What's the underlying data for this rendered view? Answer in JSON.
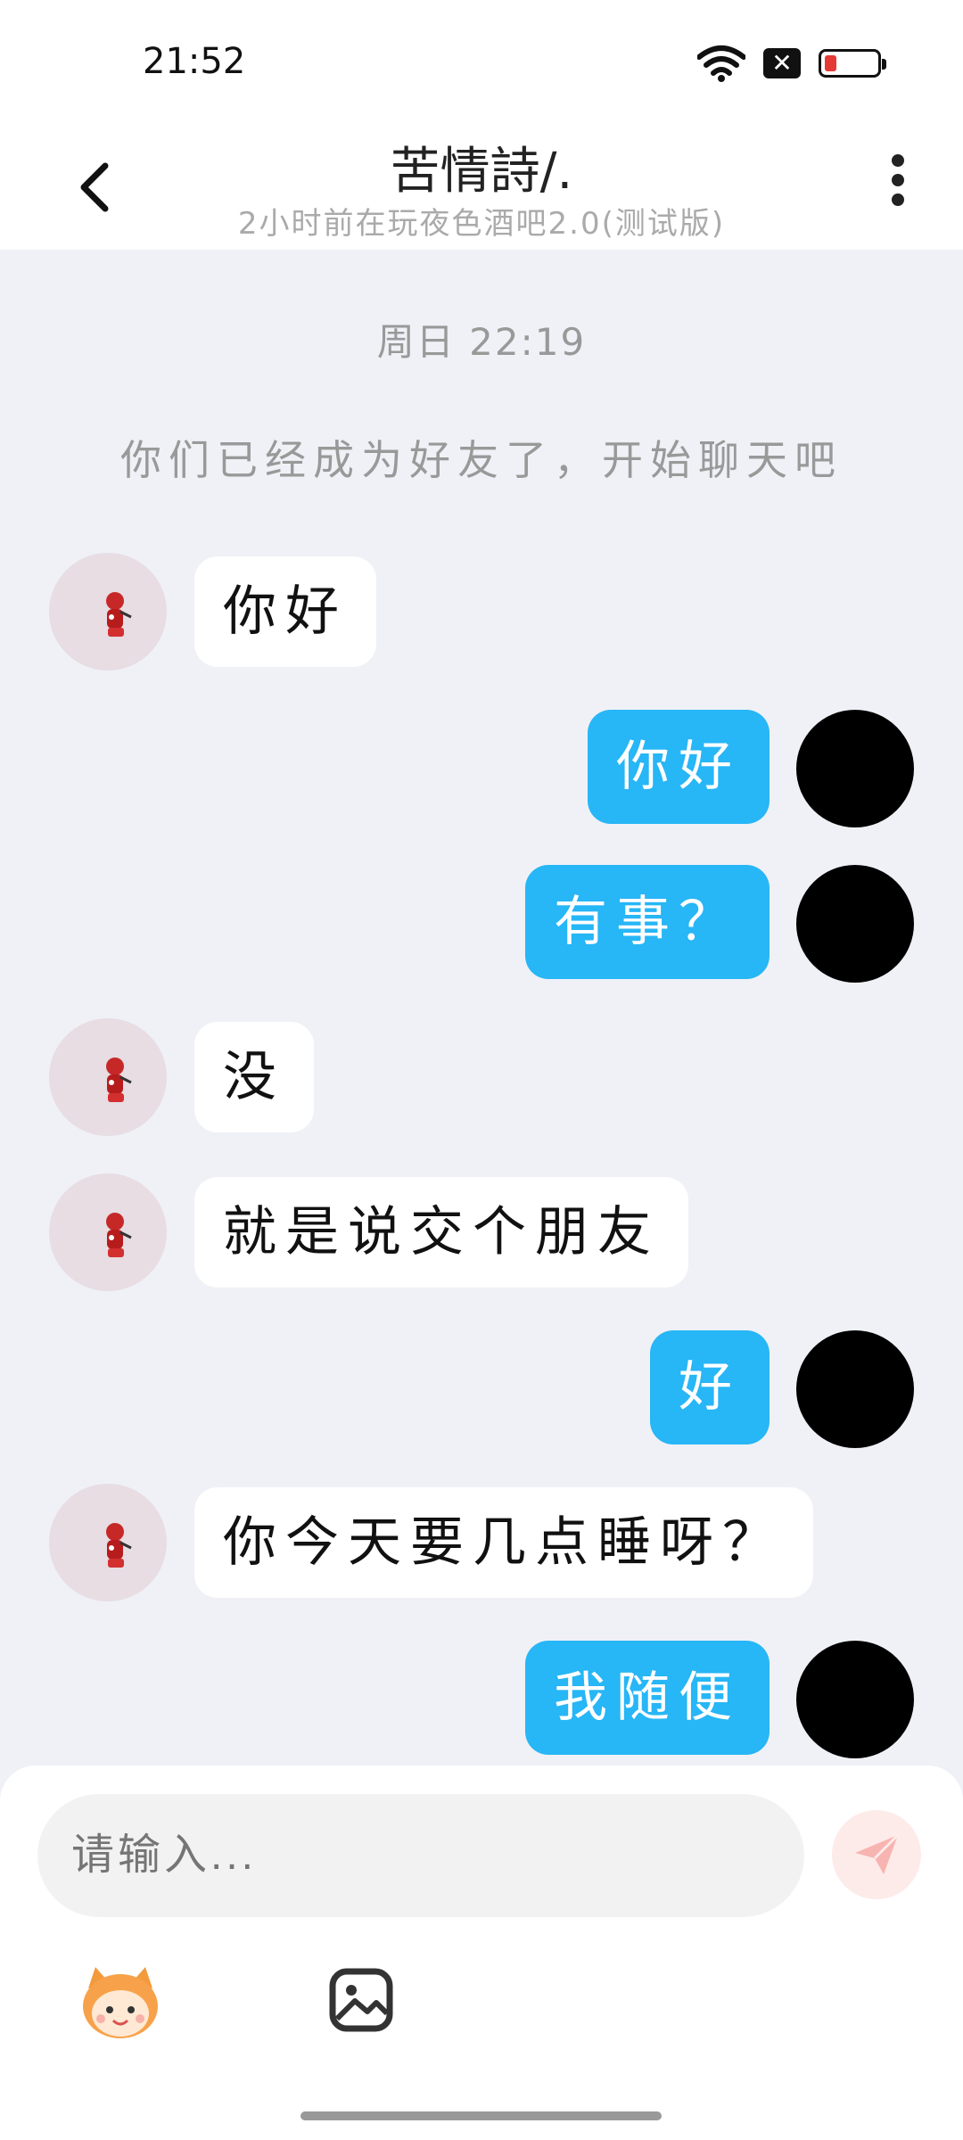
{
  "status_bar": {
    "time": "21:52"
  },
  "header": {
    "title": "苦情詩/.",
    "subtitle": "2小时前在玩夜色酒吧2.0(测试版)"
  },
  "chat": {
    "timestamp": "周日 22:19",
    "system_message": "你们已经成为好友了，开始聊天吧",
    "messages": [
      {
        "side": "left",
        "text": "你好"
      },
      {
        "side": "right",
        "text": "你好"
      },
      {
        "side": "right",
        "text": "有事？"
      },
      {
        "side": "left",
        "text": "没"
      },
      {
        "side": "left",
        "text": "就是说交个朋友"
      },
      {
        "side": "right",
        "text": "好"
      },
      {
        "side": "left",
        "text": "你今天要几点睡呀？"
      },
      {
        "side": "right",
        "text": "我随便"
      }
    ]
  },
  "composer": {
    "placeholder": "请输入...",
    "send_icon": "paper-plane-icon",
    "tools": [
      "emoji-mascot-icon",
      "image-icon"
    ]
  },
  "colors": {
    "outgoing_bubble": "#27b6f6",
    "incoming_bubble": "#ffffff",
    "chat_background": "#eff1f6",
    "send_button_bg": "#fdebea"
  }
}
